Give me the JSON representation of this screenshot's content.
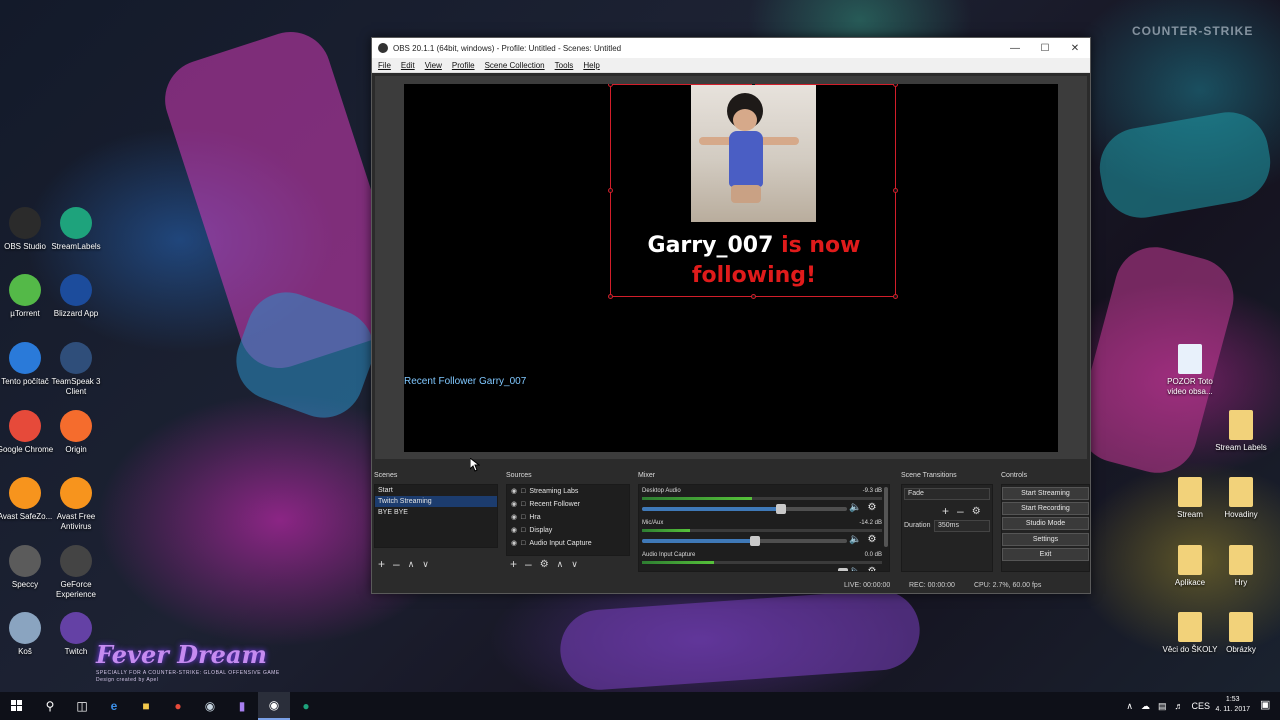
{
  "desktop": {
    "left_icons": [
      {
        "label": "OBS Studio",
        "icon": "obs-icon",
        "color": "#2b2b2b"
      },
      {
        "label": "StreamLabels",
        "icon": "streamlabels-icon",
        "color": "#1ea37c"
      },
      {
        "label": "µTorrent",
        "icon": "utorrent-icon",
        "color": "#54b948"
      },
      {
        "label": "Blizzard App",
        "icon": "blizzard-icon",
        "color": "#1c4c9c"
      },
      {
        "label": "Tento počítač",
        "icon": "computer-icon",
        "color": "#2a7ad9"
      },
      {
        "label": "TeamSpeak 3 Client",
        "icon": "teamspeak-icon",
        "color": "#2f4e7a"
      },
      {
        "label": "Google Chrome",
        "icon": "chrome-icon",
        "color": "#e64a3a"
      },
      {
        "label": "Origin",
        "icon": "origin-icon",
        "color": "#f56c2d"
      },
      {
        "label": "Avast SafeZo...",
        "icon": "avast-safezone-icon",
        "color": "#f7941d"
      },
      {
        "label": "Avast Free Antivirus",
        "icon": "avast-icon",
        "color": "#f7941d"
      },
      {
        "label": "Speccy",
        "icon": "speccy-icon",
        "color": "#5b5b5b"
      },
      {
        "label": "GeForce Experience",
        "icon": "geforce-icon",
        "color": "#444"
      },
      {
        "label": "Koš",
        "icon": "recycle-bin-icon",
        "color": "#8aa4c0"
      },
      {
        "label": "Twitch",
        "icon": "twitch-icon",
        "color": "#6441a5"
      }
    ],
    "right_icons": [
      {
        "label": "POZOR Toto video obsa...",
        "icon": "video-file-icon",
        "color": "#e8f1fb"
      },
      {
        "label": "Stream Labels",
        "icon": "folder-icon",
        "color": "#f2d27a"
      },
      {
        "label": "Stream",
        "icon": "folder-icon",
        "color": "#f2d27a"
      },
      {
        "label": "Hovadiny",
        "icon": "folder-icon",
        "color": "#f2d27a"
      },
      {
        "label": "Aplikace",
        "icon": "folder-icon",
        "color": "#f2d27a"
      },
      {
        "label": "Hry",
        "icon": "folder-icon",
        "color": "#f2d27a"
      },
      {
        "label": "Věci do ŠKOLY",
        "icon": "folder-icon",
        "color": "#f2d27a"
      },
      {
        "label": "Obrázky",
        "icon": "folder-icon",
        "color": "#f2d27a"
      }
    ],
    "cs_logo": "COUNTER-STRIKE",
    "wallpaper_title": "Fever Dream",
    "wallpaper_subtitle": "SPECIALLY FOR A COUNTER-STRIKE: GLOBAL OFFENSIVE GAME",
    "wallpaper_credit": "Design created by Apel"
  },
  "obs": {
    "title": "OBS 20.1.1 (64bit, windows) - Profile: Untitled - Scenes: Untitled",
    "menu": [
      "File",
      "Edit",
      "View",
      "Profile",
      "Scene Collection",
      "Tools",
      "Help"
    ],
    "alert": {
      "name": "Garry_007",
      "rest1": " is now",
      "rest2": "following!"
    },
    "recent_follower": "Recent Follower Garry_007",
    "docks": {
      "scenes": "Scenes",
      "sources": "Sources",
      "mixer": "Mixer",
      "transitions": "Scene Transitions",
      "controls": "Controls"
    },
    "scenes": [
      "Start",
      "Twitch Streaming",
      "BYE BYE"
    ],
    "selected_scene": "Twitch Streaming",
    "sources": [
      "Streaming Labs",
      "Recent Follower",
      "Hra",
      "Display",
      "Audio Input Capture"
    ],
    "mixer": [
      {
        "name": "Desktop Audio",
        "db": "-9.3 dB",
        "level": 0.46,
        "volume": 0.68
      },
      {
        "name": "Mic/Aux",
        "db": "-14.2 dB",
        "level": 0.2,
        "volume": 0.55
      },
      {
        "name": "Audio Input Capture",
        "db": "0.0 dB",
        "level": 0.3,
        "volume": 0.98
      }
    ],
    "transition": "Fade",
    "duration_label": "Duration",
    "duration_value": "350ms",
    "controls": [
      "Start Streaming",
      "Start Recording",
      "Studio Mode",
      "Settings",
      "Exit"
    ],
    "status": {
      "live": "LIVE: 00:00:00",
      "rec": "REC: 00:00:00",
      "cpu": "CPU: 2.7%, 60.00 fps"
    }
  },
  "taskbar": {
    "lang": "CES",
    "time": "1:53",
    "date": "4. 11. 2017"
  },
  "colors": {
    "accent_red": "#d21e2a",
    "alert_red": "#e01b1b",
    "selection": "#1c3c6e"
  }
}
